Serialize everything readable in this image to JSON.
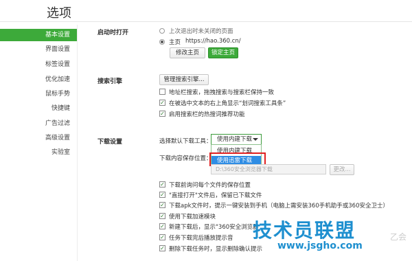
{
  "page_title": "选项",
  "sidebar": {
    "items": [
      {
        "label": "基本设置",
        "active": true
      },
      {
        "label": "界面设置"
      },
      {
        "label": "标签设置"
      },
      {
        "label": "优化加速"
      },
      {
        "label": "鼠标手势"
      },
      {
        "label": "快捷键"
      },
      {
        "label": "广告过滤"
      },
      {
        "label": "高级设置"
      },
      {
        "label": "实验室"
      }
    ]
  },
  "startup": {
    "title": "启动时打开",
    "option1": "上次退出时未关闭的页面",
    "option2_label": "主页",
    "option2_url": "https://hao.360.cn/",
    "modify_home_button": "修改主页",
    "lock_home_button": "锁定主页"
  },
  "search": {
    "title": "搜索引擎",
    "manage_button": "管理搜索引擎...",
    "chk1": "地址栏搜索，拖拽搜索与搜索栏保持一致",
    "chk2": "在被选中文本的右上角显示“划词搜索工具条”",
    "chk3": "启用搜索栏的热搜词推荐功能"
  },
  "download": {
    "title": "下载设置",
    "tool_label": "选择默认下载工具：",
    "tool_selected": "使用内建下载",
    "dropdown_options": [
      "使用内建下载",
      "使用迅雷下载"
    ],
    "save_location_label": "下载内容保存位置：",
    "path_value": "D:\\360安全浏览器下载",
    "change_button": "更改...",
    "chk1": "下载前询问每个文件的保存位置",
    "chk2": "\"直接打开\"文件后，保留已下载文件",
    "chk3": "下载apk文件时，提示一键安装到手机（电脑上需安装360手机助手或360安全卫士）",
    "chk4": "使用下载加速模块",
    "chk5": "新建下载后，显示\"360安全浏览器",
    "chk6": "任务下载完后播放提示音",
    "chk7": "删除下载任务时，显示删除确认提示"
  },
  "watermark": {
    "title": "技术员联盟",
    "url": "www.jsgho.com",
    "side": "乙会"
  }
}
